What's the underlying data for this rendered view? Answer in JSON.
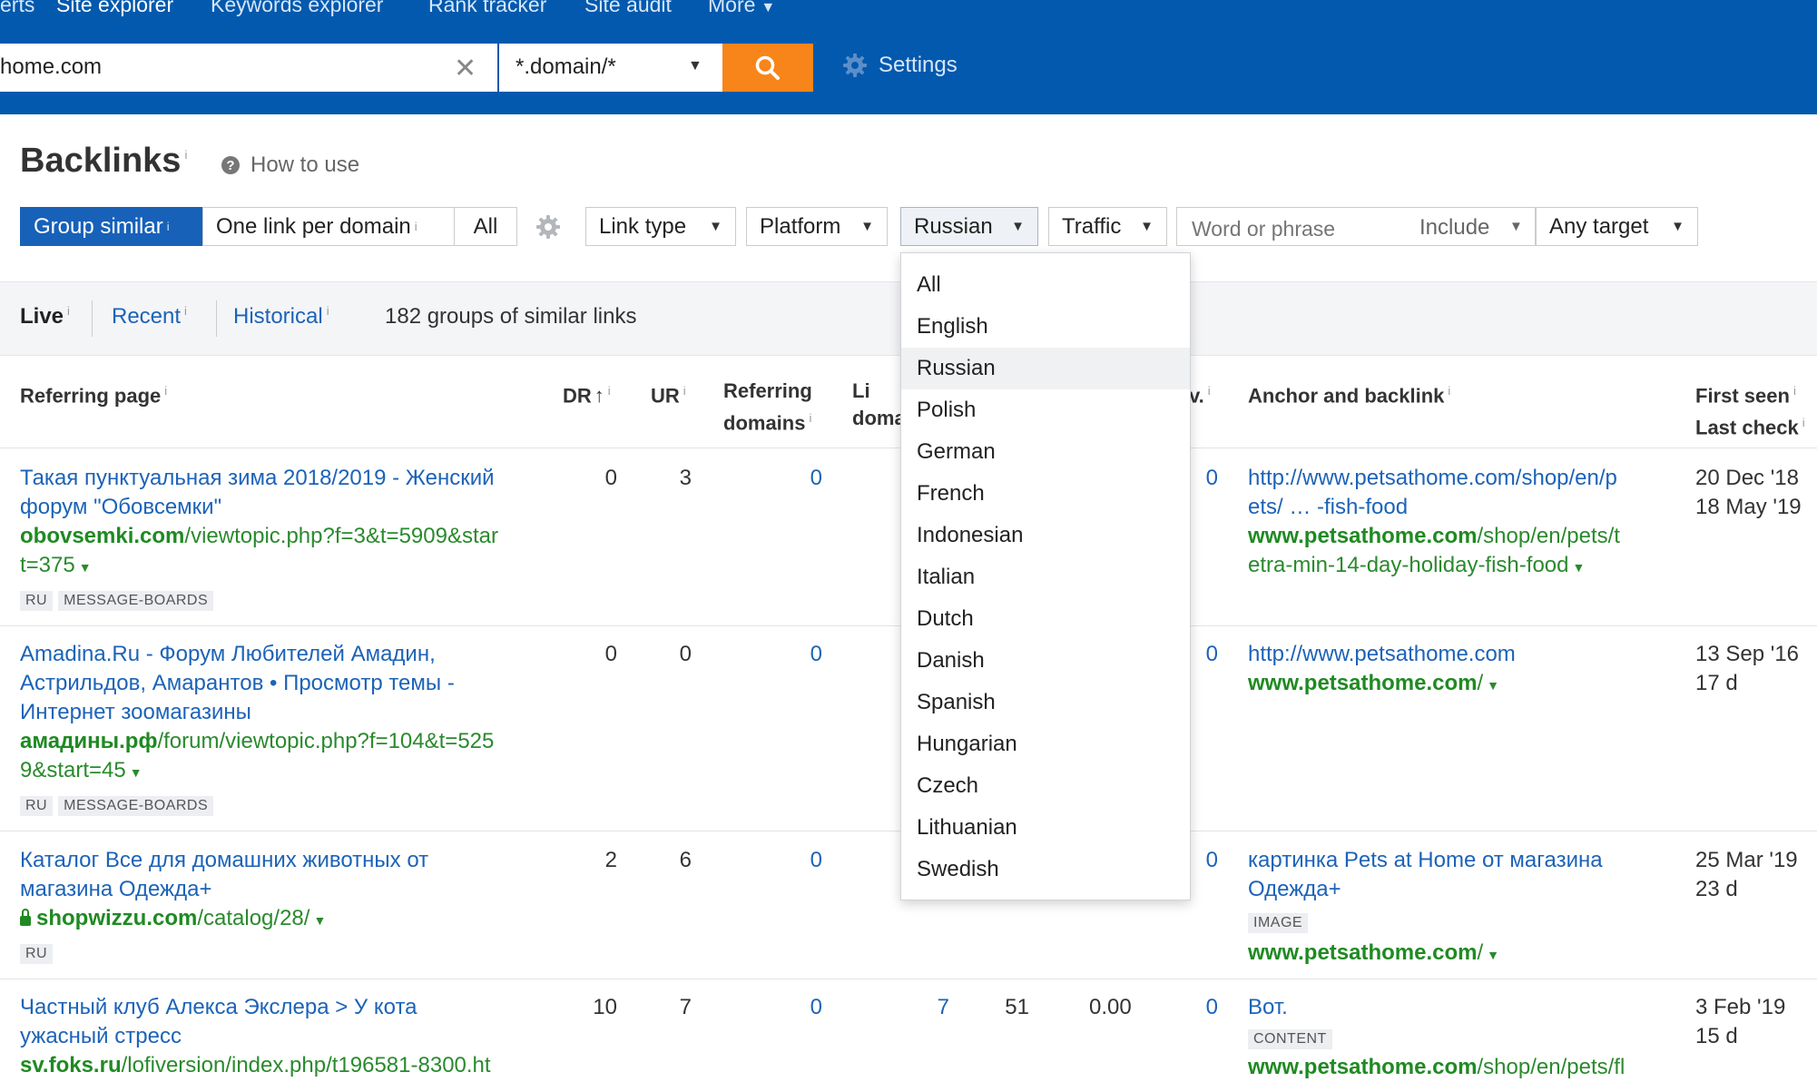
{
  "nav": {
    "items": [
      "erts",
      "Site explorer",
      "Keywords explorer",
      "Rank tracker",
      "Site audit",
      "More"
    ]
  },
  "search": {
    "value": "home.com",
    "mode": "*.domain/*",
    "settings_label": "Settings"
  },
  "page": {
    "title": "Backlinks",
    "info_mark": "i",
    "how_to_use": "How to use"
  },
  "filters": {
    "group_similar": "Group similar",
    "one_link_per_domain": "One link per domain",
    "all": "All",
    "link_type": "Link type",
    "platform": "Platform",
    "language": "Russian",
    "traffic": "Traffic",
    "phrase_placeholder": "Word or phrase",
    "include": "Include",
    "any_target": "Any target"
  },
  "tabs": {
    "live": "Live",
    "recent": "Recent",
    "historical": "Historical",
    "summary": "182 groups of similar links"
  },
  "columns": {
    "referring_page": "Referring page",
    "dr": "DR",
    "ur": "UR",
    "referring_domains_1": "Referring",
    "referring_domains_2": "domains",
    "linked_domains_1": "Li",
    "linked_domains_2": "doma",
    "partial": "v.",
    "anchor": "Anchor and backlink",
    "first_seen": "First seen",
    "last_check": "Last check"
  },
  "rows": [
    {
      "title_1": "Такая пунктуальная зима 2018/2019 - Женский",
      "title_2": "форум \"Обовсемки\"",
      "domain": "obovsemki.com",
      "path_1": "/viewtopic.php?f=3&t=5909&star",
      "path_2": "t=375",
      "tags": [
        "RU",
        "MESSAGE-BOARDS"
      ],
      "dr": "0",
      "ur": "3",
      "ref_domains": "0",
      "partial": "0",
      "anchor_1": "http://www.petsathome.com/shop/en/p",
      "anchor_2": "ets/ … -fish-food",
      "target_domain": "www.petsathome.com",
      "target_path_1": "/shop/en/pets/t",
      "target_path_2": "etra-min-14-day-holiday-fish-food",
      "first_seen": "20 Dec '18",
      "last_check": "18 May '19"
    },
    {
      "title_1": "Amadina.Ru - Форум Любителей Амадин,",
      "title_2": "Астрильдов, Амарантов • Просмотр темы -",
      "title_3": "Интернет зоомагазины",
      "domain": "амадины.рф",
      "path_1": "/forum/viewtopic.php?f=104&t=525",
      "path_2": "9&start=45",
      "tags": [
        "RU",
        "MESSAGE-BOARDS"
      ],
      "dr": "0",
      "ur": "0",
      "ref_domains": "0",
      "partial": "0",
      "anchor_1": "http://www.petsathome.com",
      "target_domain": "www.petsathome.com",
      "target_path_1": "/",
      "first_seen": "13 Sep '16",
      "last_check": "17 d"
    },
    {
      "title_1": "Каталог Все для домашних животных от",
      "title_2": "магазина Одежда+",
      "domain": "shopwizzu.com",
      "path_1": "/catalog/28/",
      "tags": [
        "RU"
      ],
      "dr": "2",
      "ur": "6",
      "ref_domains": "0",
      "partial": "0",
      "anchor_1": "картинка Pets at Home от магазина",
      "anchor_2": "Одежда+",
      "anchor_tag": "IMAGE",
      "target_domain": "www.petsathome.com",
      "target_path_1": "/",
      "first_seen": "25 Mar '19",
      "last_check": "23 d"
    },
    {
      "title_1": "Частный клуб Алекса Экслера > У кота",
      "title_2": "ужасный стресс",
      "domain": "sv.foks.ru",
      "path_1": "/lofiversion/index.php/t196581-8300.ht",
      "dr": "10",
      "ur": "7",
      "ref_domains": "0",
      "linked_domains": "7",
      "ext": "51",
      "traffic": "0.00",
      "partial": "0",
      "anchor_1": "Вот.",
      "anchor_tag": "CONTENT",
      "target_domain": "www.petsathome.com",
      "target_path_1": "/shop/en/pets/fl",
      "first_seen": "3 Feb '19",
      "last_check": "15 d"
    }
  ],
  "language_menu": {
    "selected": "Russian",
    "options": [
      "All",
      "English",
      "Russian",
      "Polish",
      "German",
      "French",
      "Indonesian",
      "Italian",
      "Dutch",
      "Danish",
      "Spanish",
      "Hungarian",
      "Czech",
      "Lithuanian",
      "Swedish"
    ]
  },
  "colors": {
    "header_bg": "#0359ae",
    "search_button": "#f7851a",
    "active_segment": "#1761b9",
    "link": "#1c63b8",
    "green_url": "#1f8a22"
  }
}
